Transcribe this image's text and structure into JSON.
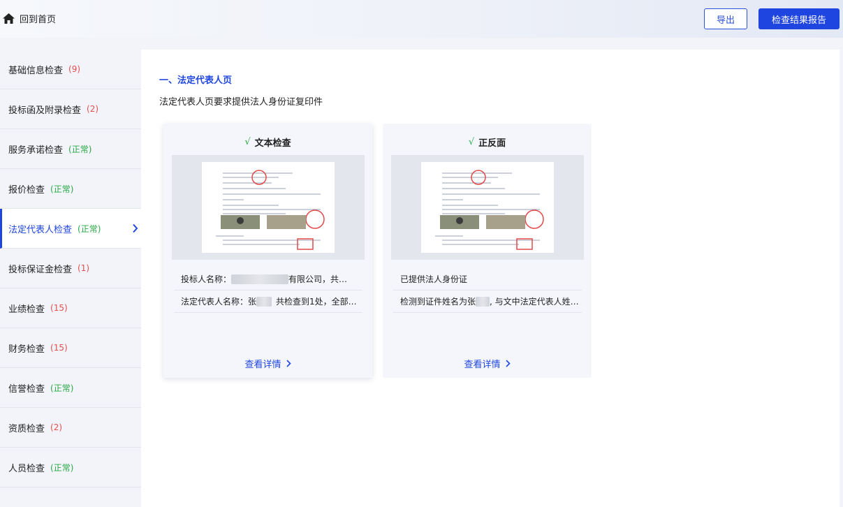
{
  "header": {
    "home_label": "回到首页",
    "export_label": "导出",
    "report_label": "检查结果报告"
  },
  "sidebar": {
    "items": [
      {
        "label": "基础信息检查",
        "count": "(9)"
      },
      {
        "label": "投标函及附录检查",
        "count": "(2)"
      },
      {
        "label": "服务承诺检查",
        "count": "(正常)"
      },
      {
        "label": "报价检查",
        "count": "(正常)"
      },
      {
        "label": "法定代表人检查",
        "count": "(正常)",
        "active": true
      },
      {
        "label": "投标保证金检查",
        "count": "(1)"
      },
      {
        "label": "业绩检查",
        "count": "(15)"
      },
      {
        "label": "财务检查",
        "count": "(15)"
      },
      {
        "label": "信誉检查",
        "count": "(正常)"
      },
      {
        "label": "资质检查",
        "count": "(2)"
      },
      {
        "label": "人员检查",
        "count": "(正常)"
      }
    ]
  },
  "main": {
    "section_title": "一、法定代表人页",
    "description": "法定代表人页要求提供法人身份证复印件",
    "cards": [
      {
        "check": "√",
        "title": "文本检查",
        "rows": [
          {
            "before": "投标人名称：",
            "after": "有限公司，共…"
          },
          {
            "before": "法定代表人名称：张",
            "after": "共检查到1处，全部…"
          }
        ],
        "link": "查看详情"
      },
      {
        "check": "√",
        "title": "正反面",
        "rows": [
          {
            "before": "已提供法人身份证",
            "after": ""
          },
          {
            "before": "检测到证件姓名为张",
            "after": ", 与文中法定代表人姓…"
          }
        ],
        "link": "查看详情"
      }
    ]
  },
  "colors": {
    "accent": "#1f45e0",
    "count_red": "#e34d4d",
    "count_green": "#27a844"
  },
  "icons": {
    "home": "home-icon",
    "active_chevron": "chevron-right-icon",
    "link_chevron": "chevron-right-icon"
  }
}
